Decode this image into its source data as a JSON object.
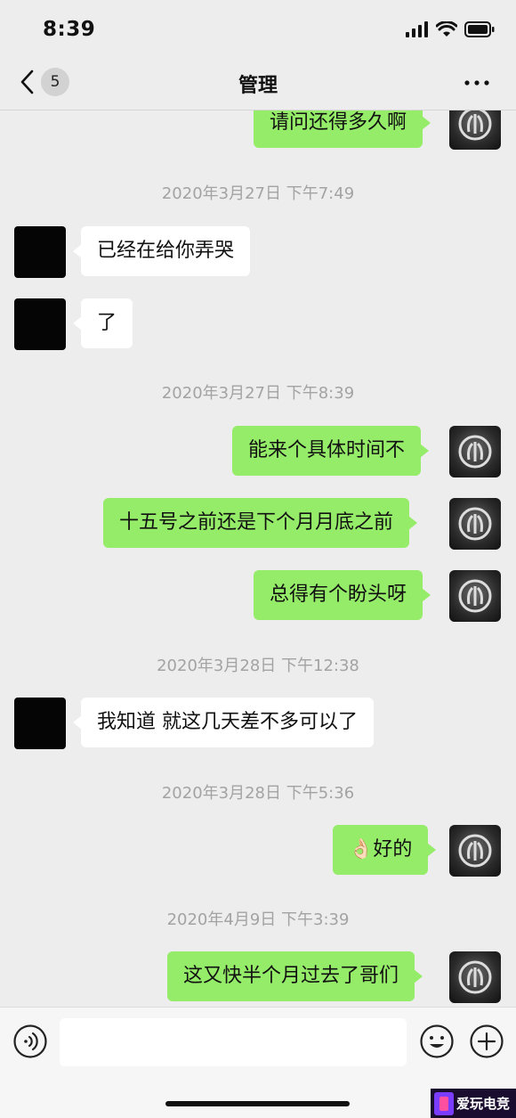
{
  "status_bar": {
    "time": "8:39"
  },
  "nav": {
    "unread_count": "5",
    "title": "管理"
  },
  "messages": [
    {
      "text": "请问还得多久啊"
    },
    {
      "time": "2020年3月27日 下午7:49"
    },
    {
      "text": "已经在给你弄哭"
    },
    {
      "text": "了"
    },
    {
      "time": "2020年3月27日 下午8:39"
    },
    {
      "text": "能来个具体时间不"
    },
    {
      "text": "十五号之前还是下个月月底之前"
    },
    {
      "text": "总得有个盼头呀"
    },
    {
      "time": "2020年3月28日 下午12:38"
    },
    {
      "text": "我知道 就这几天差不多可以了"
    },
    {
      "time": "2020年3月28日 下午5:36"
    },
    {
      "text": "👌🏻好的"
    },
    {
      "time": "2020年4月9日 下午3:39"
    },
    {
      "text": "这又快半个月过去了哥们"
    }
  ],
  "input": {
    "value": ""
  },
  "watermark": {
    "text": "爱玩电竞"
  },
  "colors": {
    "outgoing_bubble": "#95ec69",
    "incoming_bubble": "#ffffff",
    "background": "#ededed"
  }
}
